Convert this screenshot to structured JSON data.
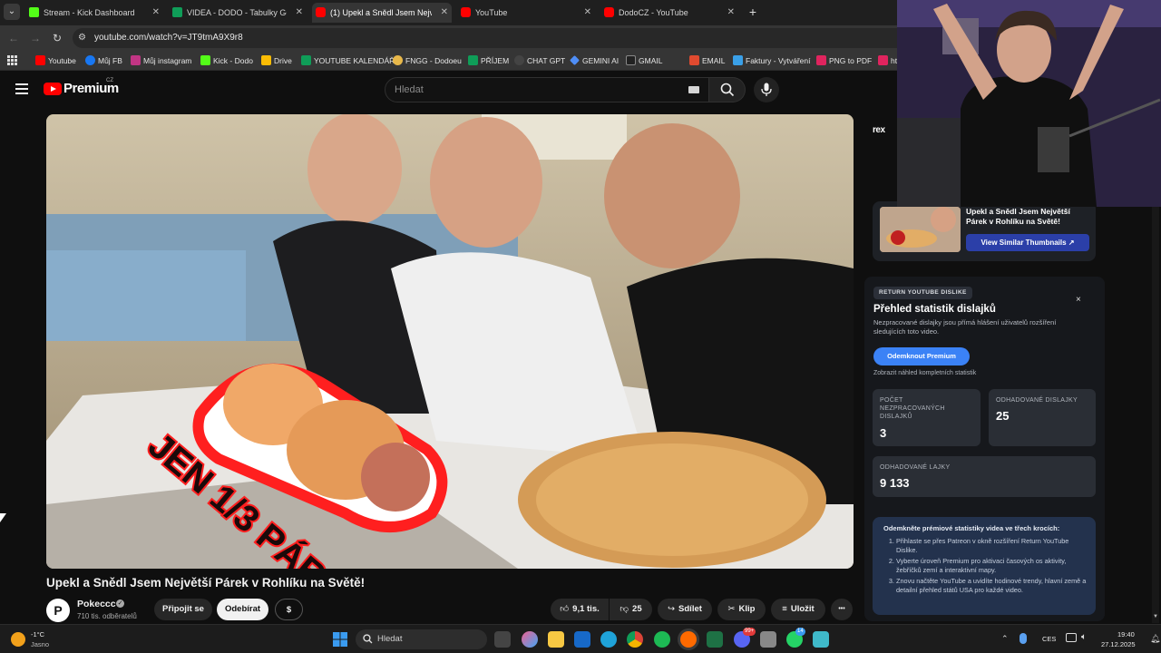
{
  "tabs": [
    {
      "title": "Stream - Kick Dashboard",
      "color": "#53fc18"
    },
    {
      "title": "VIDEA - DODO - Tabulky Googl",
      "color": "#0f9d58"
    },
    {
      "title": "(1) Upekl a Snědl Jsem Největší",
      "color": "#ff0000"
    },
    {
      "title": "YouTube",
      "color": "#ff0000"
    },
    {
      "title": "DodoCZ - YouTube",
      "color": "#ff0000"
    }
  ],
  "address": {
    "url": "youtube.com/watch?v=JT9tmA9X9r8"
  },
  "bookmarks": [
    {
      "label": "Youtube",
      "color": "#ff0000"
    },
    {
      "label": "Můj FB",
      "color": "#1877f2"
    },
    {
      "label": "Můj instagram",
      "color": "#c13584"
    },
    {
      "label": "Kick - Dodo",
      "color": "#53fc18"
    },
    {
      "label": "Drive",
      "color": "#fbbc04"
    },
    {
      "label": "YOUTUBE KALENDÁŘ",
      "color": "#0f9d58"
    },
    {
      "label": "FNGG - Dodoeu",
      "color": "#e8b84a"
    },
    {
      "label": "PŘÍJEM",
      "color": "#0f9d58"
    },
    {
      "label": "CHAT GPT",
      "color": "#444444"
    },
    {
      "label": "GEMINI AI",
      "color": "#4f8ef7"
    },
    {
      "label": "GMAIL",
      "color": "#222222"
    },
    {
      "label": "EMAIL",
      "color": "#e04a2f"
    },
    {
      "label": "Faktury - Vytváření",
      "color": "#3aa0e8"
    },
    {
      "label": "PNG to PDF",
      "color": "#e0245e"
    },
    {
      "label": "ht",
      "color": "#e0245e"
    }
  ],
  "masthead": {
    "brand": "Premium",
    "country": "CZ",
    "search_placeholder": "Hledat"
  },
  "video": {
    "title": "Upekl a Snědl Jsem Největší Párek v Rohlíku na Světě!",
    "overlay_text": "JEN 1/3 PÁRKU"
  },
  "channel": {
    "name": "Pokeccc",
    "subs": "710 tis. odběratelů",
    "avatar_letter": "P"
  },
  "actions": {
    "join": "Připojit se",
    "subscribe": "Odebírat",
    "tip": "$",
    "likes": "9,1 tis.",
    "dislikes": "25",
    "share": "Sdílet",
    "clip": "Klip",
    "save": "Uložit",
    "more": "•••"
  },
  "similar_card": {
    "title": "Upekl a Snědl Jsem Největší Párek v Rohlíku na Světě!",
    "button": "View Similar Thumbnails",
    "logo": "rex"
  },
  "rye": {
    "tag": "RETURN YOUTUBE DISLIKE",
    "title": "Přehled statistik dislajků",
    "desc": "Nezpracované dislajky jsou přímá hlášení uživatelů rozšíření sledujících toto video.",
    "close": "×",
    "unlock": "Odemknout Premium",
    "preview": "Zobrazit náhled kompletních statistik",
    "stats": [
      {
        "label": "POČET NEZPRACOVANÝCH DISLAJKŮ",
        "value": "3"
      },
      {
        "label": "ODHADOVANÉ DISLAJKY",
        "value": "25"
      },
      {
        "label": "ODHADOVANÉ LAJKY",
        "value": "9 133"
      }
    ],
    "steps_title": "Odemkněte prémiové statistiky videa ve třech krocích:",
    "steps": [
      "Přihlaste se přes Patreon v okně rozšíření Return YouTube Dislike.",
      "Vyberte úroveň Premium pro aktivaci časových os aktivity, žebříčků zemí a interaktivní mapy.",
      "Znovu načtěte YouTube a uvidíte hodinové trendy, hlavní země a detailní přehled států USA pro každé video."
    ]
  },
  "taskbar": {
    "temp": "-1°C",
    "weather": "Jasno",
    "search_placeholder": "Hledat",
    "lang": "CES",
    "time": "19:40",
    "date": "27.12.2025",
    "badge_discord": "99+",
    "badge_whatsapp": "14"
  }
}
